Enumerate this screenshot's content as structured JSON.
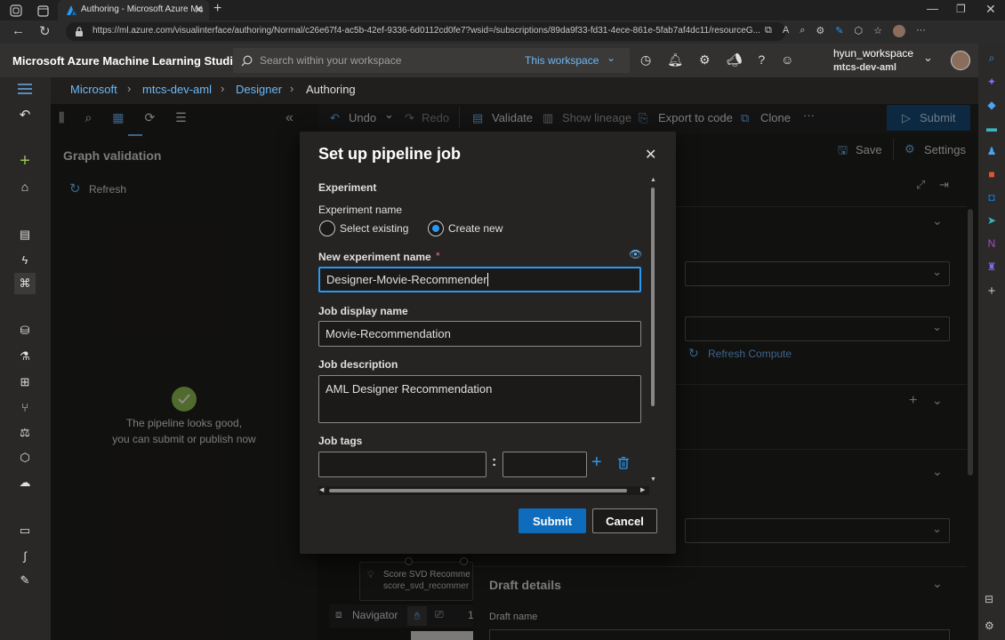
{
  "browser": {
    "tab_title": "Authoring - Microsoft Azure Ma",
    "url": "https://ml.azure.com/visualinterface/authoring/Normal/c26e67f4-ac5b-42ef-9336-6d0112cd0fe7?wsid=/subscriptions/89da9f33-fd31-4ece-861e-5fab7af4dc11/resourceG..."
  },
  "header": {
    "app_title": "Microsoft Azure Machine Learning Studio",
    "search_placeholder": "Search within your workspace",
    "scope": "This workspace",
    "workspace_name": "hyun_workspace",
    "workspace_sub": "mtcs-dev-aml"
  },
  "breadcrumb": [
    "Microsoft",
    "mtcs-dev-aml",
    "Designer",
    "Authoring"
  ],
  "left_panel": {
    "title": "Graph validation",
    "refresh": "Refresh",
    "message_line1": "The pipeline looks good,",
    "message_line2": "you can submit or publish now"
  },
  "toolbar": {
    "undo": "Undo",
    "redo": "Redo",
    "validate": "Validate",
    "show_lineage": "Show lineage",
    "export": "Export to code",
    "clone": "Clone",
    "more": "···",
    "submit": "Submit",
    "save": "Save",
    "settings": "Settings"
  },
  "right_panel": {
    "refresh_compute": "Refresh Compute",
    "draft_details": "Draft details",
    "draft_name": "Draft name"
  },
  "canvas": {
    "node_line1": "Score SVD Recomme",
    "node_line2": "score_svd_recommer",
    "navigator": "Navigator",
    "zoom_partial": "1"
  },
  "dialog": {
    "title": "Set up pipeline job",
    "section": "Experiment",
    "exp_name_label": "Experiment name",
    "opt_existing": "Select existing",
    "opt_new": "Create new",
    "selected_option": "Create new",
    "new_exp_label": "New experiment name",
    "required_mark": "*",
    "new_exp_value": "Designer-Movie-Recommender",
    "display_label": "Job display name",
    "display_value": "Movie-Recommendation",
    "desc_label": "Job description",
    "desc_value": "AML Designer Recommendation",
    "tags_label": "Job tags",
    "tag_sep": ":",
    "submit": "Submit",
    "cancel": "Cancel"
  },
  "colors": {
    "accent": "#0f6cbd",
    "link": "#6cb8f6",
    "success": "#92c353",
    "required": "#f1707b"
  }
}
